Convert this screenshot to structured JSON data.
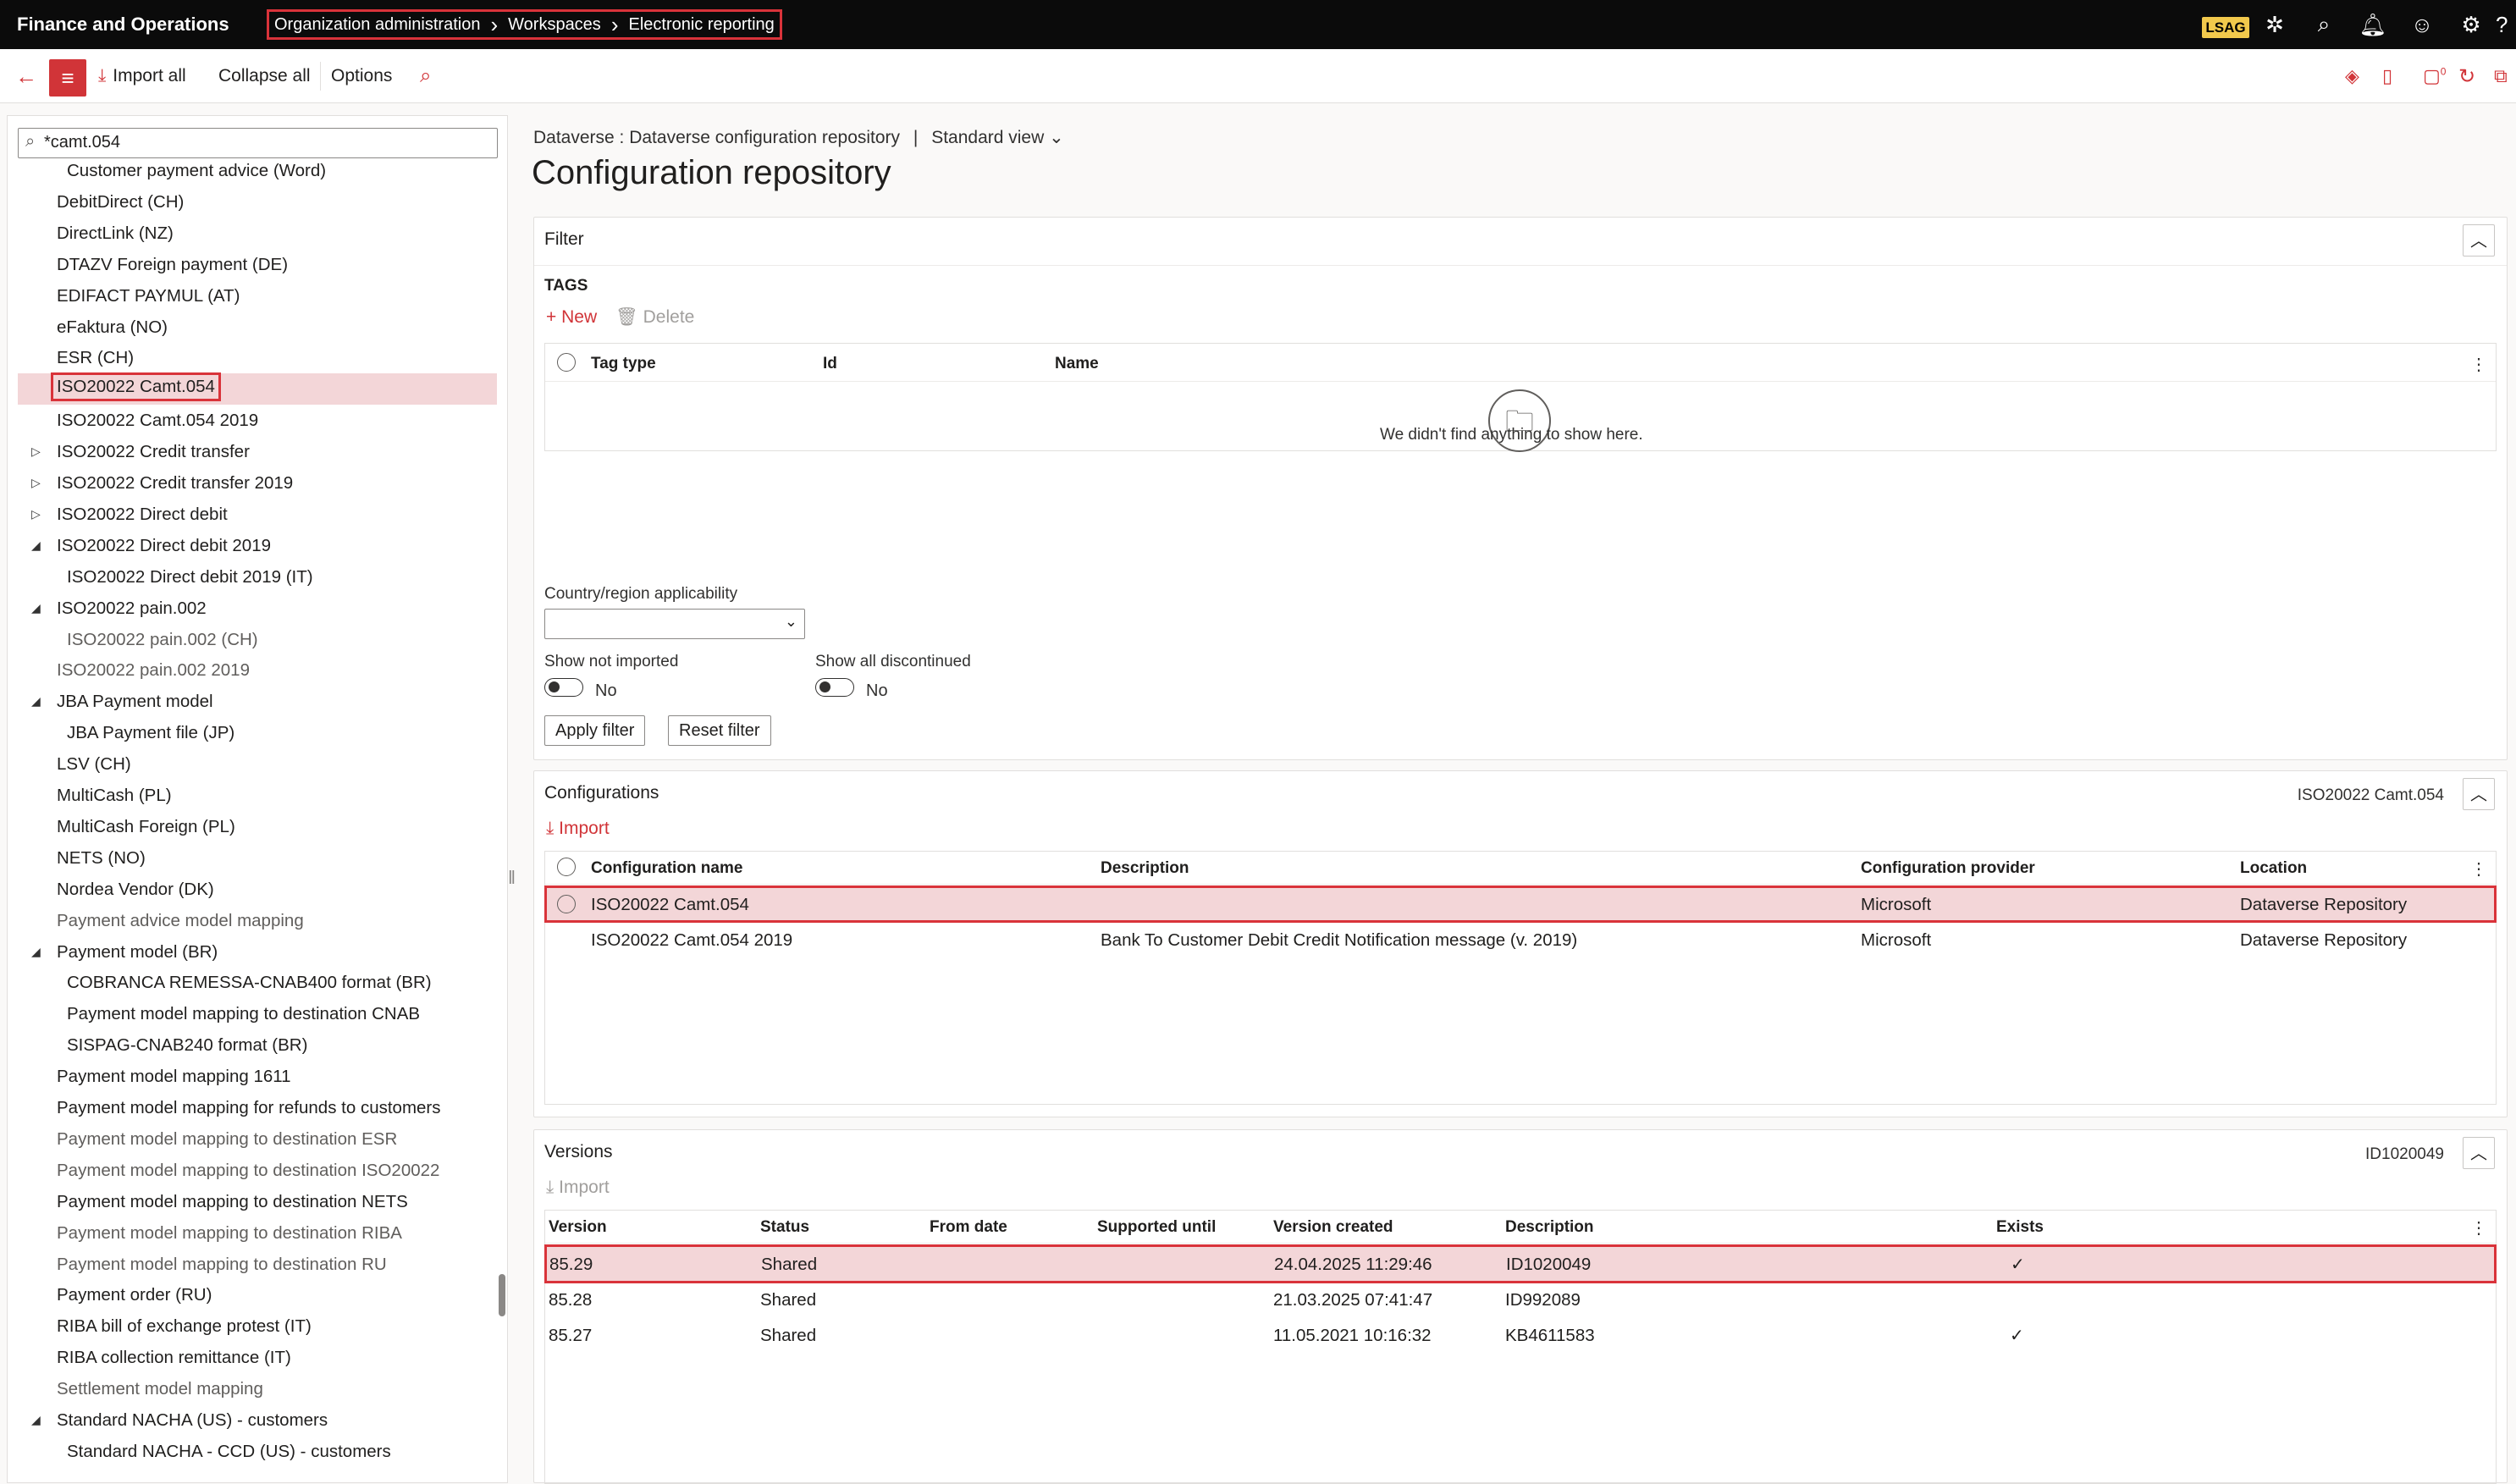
{
  "topbar": {
    "app_name": "Finance and Operations",
    "breadcrumb": [
      "Organization administration",
      "Workspaces",
      "Electronic reporting"
    ],
    "company": "LSAG",
    "icons": [
      "copilot-icon",
      "search-icon",
      "notifications-icon",
      "feedback-smiley-icon",
      "settings-gear-icon",
      "help-icon"
    ]
  },
  "toolbar": {
    "import_all": "Import all",
    "collapse_all": "Collapse all",
    "options": "Options",
    "badge_count": "0",
    "right_icons": [
      "diamond-icon",
      "office-icon",
      "notification-badge-icon",
      "refresh-icon",
      "open-new-window-icon"
    ]
  },
  "tree": {
    "search_value": "*camt.054",
    "items": [
      {
        "label": "Customer payment advice (Word)",
        "indent": 2,
        "expander": "",
        "style": "bold"
      },
      {
        "label": "DebitDirect (CH)",
        "indent": 1,
        "expander": "",
        "style": "bold"
      },
      {
        "label": "DirectLink (NZ)",
        "indent": 1,
        "expander": "",
        "style": "bold"
      },
      {
        "label": "DTAZV Foreign payment (DE)",
        "indent": 1,
        "expander": "",
        "style": "bold"
      },
      {
        "label": "EDIFACT PAYMUL (AT)",
        "indent": 1,
        "expander": "",
        "style": "bold"
      },
      {
        "label": "eFaktura (NO)",
        "indent": 1,
        "expander": "",
        "style": "bold"
      },
      {
        "label": "ESR (CH)",
        "indent": 1,
        "expander": "",
        "style": "bold"
      },
      {
        "label": "ISO20022 Camt.054",
        "indent": 1,
        "expander": "",
        "style": "selected"
      },
      {
        "label": "ISO20022 Camt.054 2019",
        "indent": 1,
        "expander": "",
        "style": "bold"
      },
      {
        "label": "ISO20022 Credit transfer",
        "indent": 1,
        "expander": "▷",
        "style": "bold"
      },
      {
        "label": "ISO20022 Credit transfer 2019",
        "indent": 1,
        "expander": "▷",
        "style": "bold"
      },
      {
        "label": "ISO20022 Direct debit",
        "indent": 1,
        "expander": "▷",
        "style": "bold"
      },
      {
        "label": "ISO20022 Direct debit 2019",
        "indent": 1,
        "expander": "◢",
        "style": "bold"
      },
      {
        "label": "ISO20022 Direct debit 2019 (IT)",
        "indent": 2,
        "expander": "",
        "style": "bold"
      },
      {
        "label": "ISO20022 pain.002",
        "indent": 1,
        "expander": "◢",
        "style": "bold"
      },
      {
        "label": "ISO20022 pain.002 (CH)",
        "indent": 2,
        "expander": "",
        "style": "grey"
      },
      {
        "label": "ISO20022 pain.002 2019",
        "indent": 1,
        "expander": "",
        "style": "grey"
      },
      {
        "label": "JBA Payment model",
        "indent": 1,
        "expander": "◢",
        "style": "bold"
      },
      {
        "label": "JBA Payment file (JP)",
        "indent": 2,
        "expander": "",
        "style": "bold"
      },
      {
        "label": "LSV (CH)",
        "indent": 1,
        "expander": "",
        "style": "bold"
      },
      {
        "label": "MultiCash (PL)",
        "indent": 1,
        "expander": "",
        "style": "bold"
      },
      {
        "label": "MultiCash Foreign (PL)",
        "indent": 1,
        "expander": "",
        "style": "bold"
      },
      {
        "label": "NETS (NO)",
        "indent": 1,
        "expander": "",
        "style": "bold"
      },
      {
        "label": "Nordea Vendor (DK)",
        "indent": 1,
        "expander": "",
        "style": "bold"
      },
      {
        "label": "Payment advice model mapping",
        "indent": 1,
        "expander": "",
        "style": "grey"
      },
      {
        "label": "Payment model (BR)",
        "indent": 1,
        "expander": "◢",
        "style": "bold"
      },
      {
        "label": "COBRANCA REMESSA-CNAB400 format (BR)",
        "indent": 2,
        "expander": "",
        "style": "bold"
      },
      {
        "label": "Payment model mapping to destination CNAB",
        "indent": 2,
        "expander": "",
        "style": "bold"
      },
      {
        "label": "SISPAG-CNAB240 format (BR)",
        "indent": 2,
        "expander": "",
        "style": "bold"
      },
      {
        "label": "Payment model mapping 1611",
        "indent": 1,
        "expander": "",
        "style": "bold"
      },
      {
        "label": "Payment model mapping for refunds to customers",
        "indent": 1,
        "expander": "",
        "style": "bold"
      },
      {
        "label": "Payment model mapping to destination ESR",
        "indent": 1,
        "expander": "",
        "style": "grey"
      },
      {
        "label": "Payment model mapping to destination ISO20022",
        "indent": 1,
        "expander": "",
        "style": "grey"
      },
      {
        "label": "Payment model mapping to destination NETS",
        "indent": 1,
        "expander": "",
        "style": "bold"
      },
      {
        "label": "Payment model mapping to destination RIBA",
        "indent": 1,
        "expander": "",
        "style": "grey"
      },
      {
        "label": "Payment model mapping to destination RU",
        "indent": 1,
        "expander": "",
        "style": "grey"
      },
      {
        "label": "Payment order (RU)",
        "indent": 1,
        "expander": "",
        "style": "bold"
      },
      {
        "label": "RIBA bill of exchange protest (IT)",
        "indent": 1,
        "expander": "",
        "style": "bold"
      },
      {
        "label": "RIBA collection remittance (IT)",
        "indent": 1,
        "expander": "",
        "style": "bold"
      },
      {
        "label": "Settlement model mapping",
        "indent": 1,
        "expander": "",
        "style": "grey"
      },
      {
        "label": "Standard NACHA (US) - customers",
        "indent": 1,
        "expander": "◢",
        "style": "bold"
      },
      {
        "label": "Standard NACHA - CCD (US) - customers",
        "indent": 2,
        "expander": "",
        "style": "bold"
      }
    ]
  },
  "page": {
    "breadcrumb": "Dataverse : Dataverse configuration repository",
    "view_label": "Standard view",
    "title": "Configuration repository"
  },
  "filter": {
    "header": "Filter",
    "tags_title": "TAGS",
    "new_label": "New",
    "delete_label": "Delete",
    "columns": [
      "Tag type",
      "Id",
      "Name"
    ],
    "empty_message": "We didn't find anything to show here.",
    "country_label": "Country/region applicability",
    "country_value": "",
    "show_not_imported_label": "Show not imported",
    "show_not_imported_value": "No",
    "show_all_discontinued_label": "Show all discontinued",
    "show_all_discontinued_value": "No",
    "apply_label": "Apply filter",
    "reset_label": "Reset filter"
  },
  "configurations": {
    "header": "Configurations",
    "header_right": "ISO20022 Camt.054",
    "import_label": "Import",
    "columns": [
      "Configuration name",
      "Description",
      "Configuration provider",
      "Location"
    ],
    "rows": [
      {
        "name": "ISO20022 Camt.054",
        "description": "",
        "provider": "Microsoft",
        "location": "Dataverse Repository"
      },
      {
        "name": "ISO20022 Camt.054 2019",
        "description": "Bank To Customer Debit Credit Notification message (v. 2019)",
        "provider": "Microsoft",
        "location": "Dataverse Repository"
      }
    ]
  },
  "versions": {
    "header": "Versions",
    "header_right": "ID1020049",
    "import_label": "Import",
    "columns": [
      "Version",
      "Status",
      "From date",
      "Supported until",
      "Version created",
      "Description",
      "Exists"
    ],
    "rows": [
      {
        "version": "85.29",
        "status": "Shared",
        "from": "",
        "until": "",
        "created": "24.04.2025 11:29:46",
        "description": "ID1020049",
        "exists": "✓"
      },
      {
        "version": "85.28",
        "status": "Shared",
        "from": "",
        "until": "",
        "created": "21.03.2025 07:41:47",
        "description": "ID992089",
        "exists": ""
      },
      {
        "version": "85.27",
        "status": "Shared",
        "from": "",
        "until": "",
        "created": "11.05.2021 10:16:32",
        "description": "KB4611583",
        "exists": "✓"
      }
    ]
  }
}
